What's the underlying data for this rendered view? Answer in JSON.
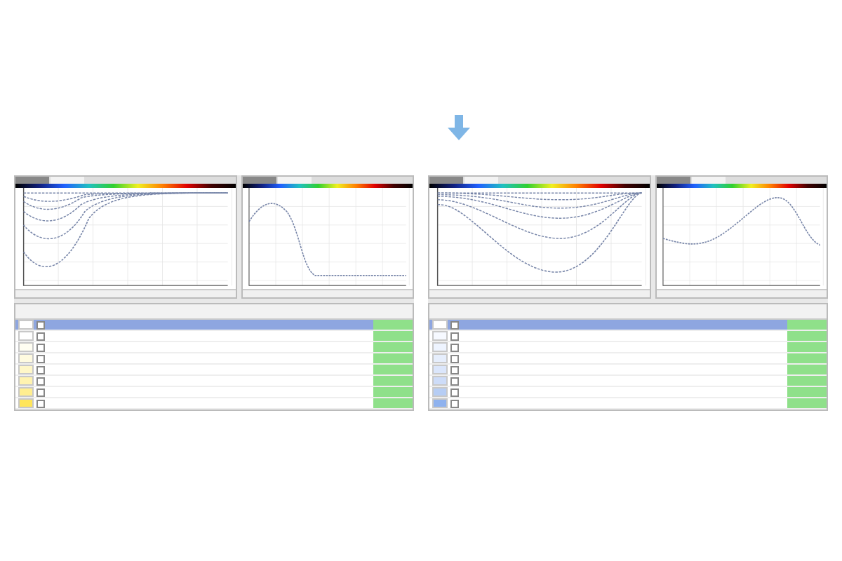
{
  "panels": [
    {
      "kind": "falling",
      "rows": [
        {
          "selected": true,
          "color": "#ffffff"
        },
        {
          "selected": false,
          "color": "#ffffff"
        },
        {
          "selected": false,
          "color": "#fffef2"
        },
        {
          "selected": false,
          "color": "#fffbe0"
        },
        {
          "selected": false,
          "color": "#fff7c8"
        },
        {
          "selected": false,
          "color": "#fff3b0"
        },
        {
          "selected": false,
          "color": "#ffee90"
        },
        {
          "selected": false,
          "color": "#ffe55a"
        }
      ]
    },
    {
      "kind": "dip",
      "rows": [
        {
          "selected": true,
          "color": "#ffffff"
        },
        {
          "selected": false,
          "color": "#f6f9ff"
        },
        {
          "selected": false,
          "color": "#eef4ff"
        },
        {
          "selected": false,
          "color": "#e6eefc"
        },
        {
          "selected": false,
          "color": "#dbe6fb"
        },
        {
          "selected": false,
          "color": "#cddcf8"
        },
        {
          "selected": false,
          "color": "#b6cdf4"
        },
        {
          "selected": false,
          "color": "#8fb2ee"
        }
      ]
    }
  ]
}
